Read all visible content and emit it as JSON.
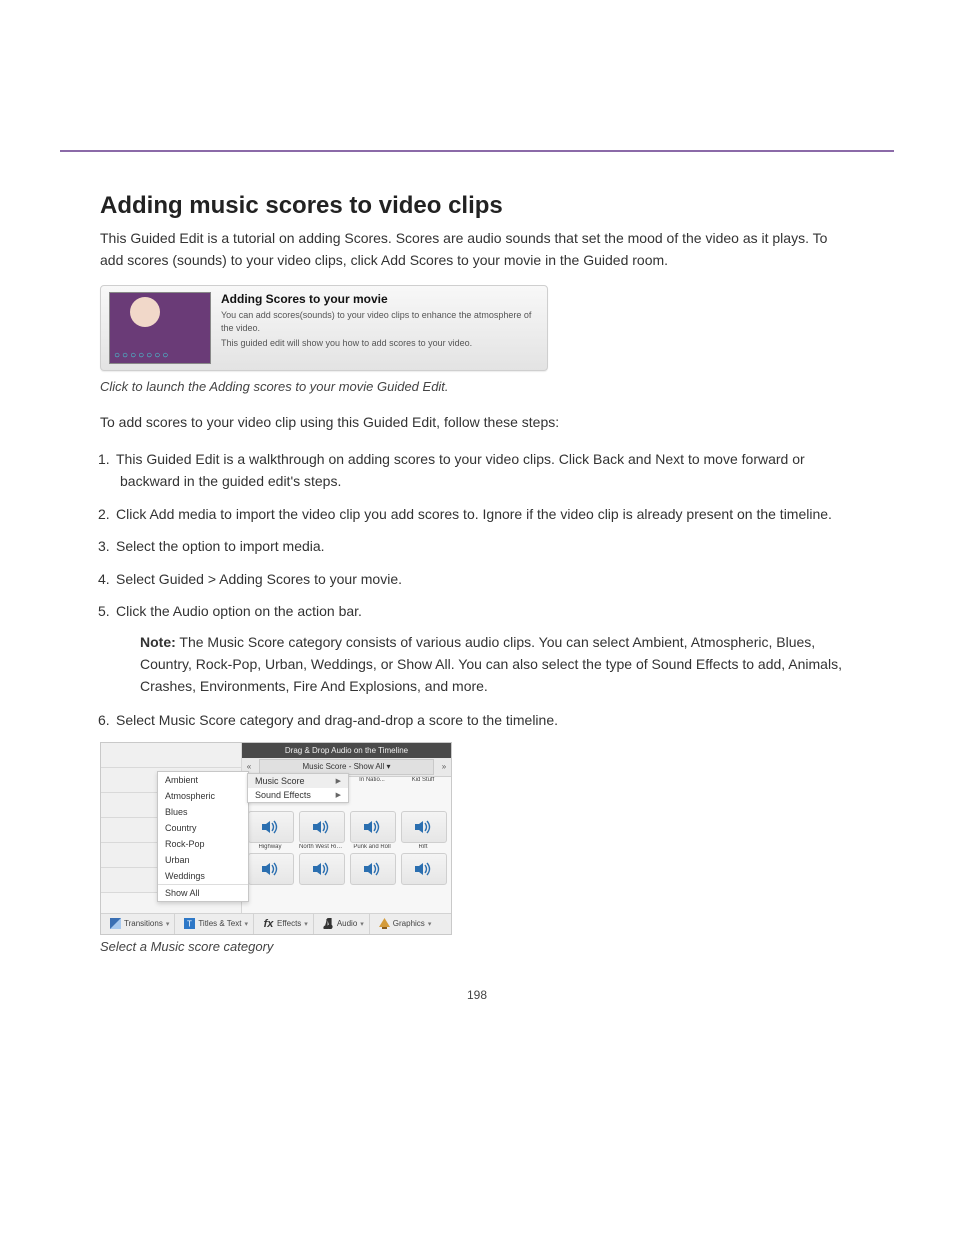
{
  "page_number": "198",
  "section": {
    "title": "Adding music scores to video clips",
    "intro": "This Guided Edit is a tutorial on adding Scores. Scores are audio sounds that set the mood of the video as it plays. To add scores (sounds) to your video clips, click Add Scores to your movie in the Guided room.",
    "guided_card": {
      "title": "Adding Scores to your movie",
      "desc1": "You can add scores(sounds) to your video clips to enhance the atmosphere of the video.",
      "desc2": "This guided edit will show you how to add scores to your video."
    },
    "caption1": "Click to launch the Adding scores to your movie Guided Edit.",
    "steps_intro": "To add scores to your video clip using this Guided Edit, follow these steps:",
    "steps": [
      "This Guided Edit is a walkthrough on adding scores to your video clips. Click Back and Next to move forward or backward in the guided edit's steps.",
      "Click Add media to import the video clip you add scores to. Ignore if the video clip is already present on the timeline.",
      "Select the option to import media.",
      "Select Guided > Adding Scores to your movie.",
      "Click the Audio option on the action bar."
    ],
    "note": {
      "label": "Note:",
      "text": "The Music Score category consists of various audio clips. You can select Ambient, Atmospheric, Blues, Country, Rock-Pop, Urban, Weddings, or Show All. You can also select the type of Sound Effects to add, Animals, Crashes, Environments, Fire And Explosions, and more."
    },
    "step6_intro": "Select Music Score category and drag-and-drop a score to the timeline.",
    "panel": {
      "header": "Drag & Drop Audio on the Timeline",
      "filter": "Music Score - Show All  ▾",
      "dropdown": [
        "Music Score",
        "Sound Effects"
      ],
      "submenu": [
        "Ambient",
        "Atmospheric",
        "Blues",
        "Country",
        "Rock-Pop",
        "Urban",
        "Weddings",
        "Show All"
      ],
      "items_row1": [
        "In Natio...",
        "Kid Stuff",
        "",
        ""
      ],
      "items_labels": [
        "Highway",
        "North West Rid...",
        "Punk and Roll",
        "Rift"
      ],
      "bottom_tabs": [
        {
          "label": "Transitions"
        },
        {
          "label": "Titles & Text"
        },
        {
          "label": "Effects"
        },
        {
          "label": "Audio"
        },
        {
          "label": "Graphics"
        }
      ]
    },
    "caption2": "Select a Music score category"
  },
  "svg_speaker": "speaker-icon"
}
